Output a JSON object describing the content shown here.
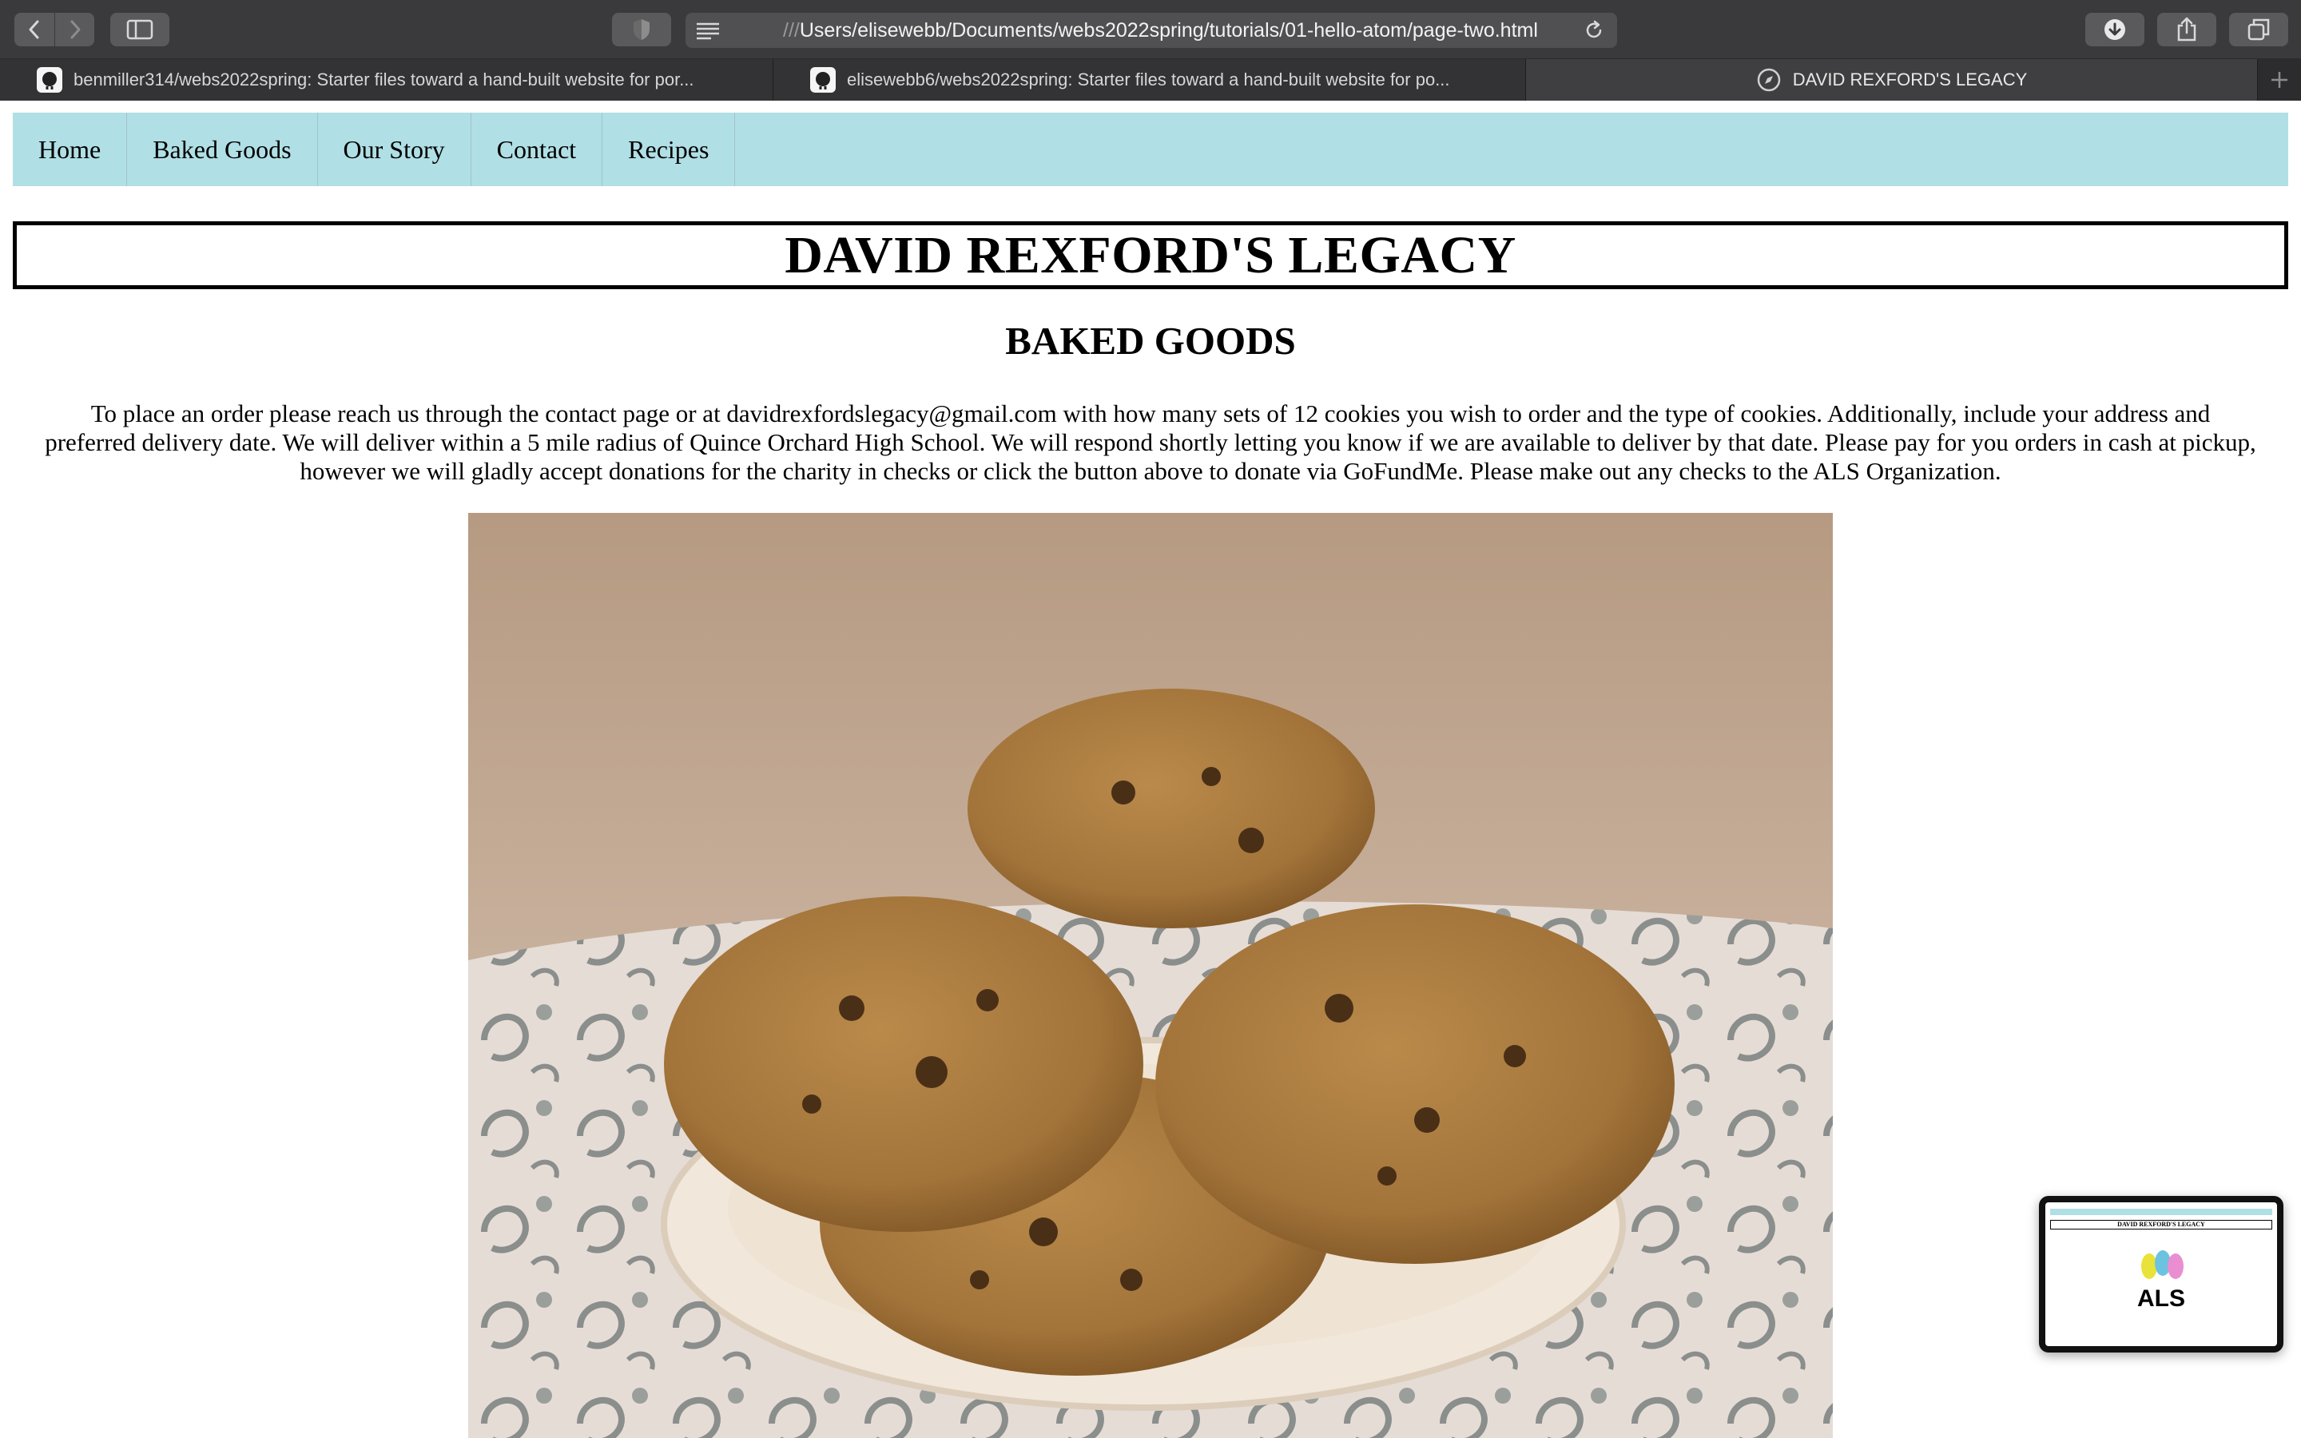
{
  "browser": {
    "url": "///Users/elisewebb/Documents/webs2022spring/tutorials/01-hello-atom/page-two.html",
    "tabs": [
      {
        "label": "benmiller314/webs2022spring: Starter files toward a hand-built website for por...",
        "icon": "github-icon"
      },
      {
        "label": "elisewebb6/webs2022spring: Starter files toward a hand-built website for po...",
        "icon": "github-icon"
      },
      {
        "label": "DAVID REXFORD'S LEGACY",
        "icon": "compass-icon"
      }
    ]
  },
  "nav": {
    "items": [
      "Home",
      "Baked Goods",
      "Our Story",
      "Contact",
      "Recipes"
    ]
  },
  "header": {
    "title": "DAVID REXFORD'S LEGACY"
  },
  "main": {
    "section_title": "BAKED GOODS",
    "intro": "To place an order please reach us through the contact page or at davidrexfordslegacy@gmail.com with how many sets of 12 cookies you wish to order and the type of cookies. Additionally, include your address and preferred delivery date. We will deliver within a 5 mile radius of Quince Orchard High School. We will respond shortly letting you know if we are available to deliver by that date. Please pay for you orders in cash at pickup, however we will gladly accept donations for the charity in checks or click the button above to donate via GoFundMe. Please make out any checks to the ALS Organization."
  },
  "thumbnail": {
    "title": "DAVID REXFORD'S LEGACY",
    "logo_text": "ALS"
  },
  "colors": {
    "nav_bg": "#b0dfe5",
    "chrome_bg": "#3a3a3c",
    "tab_bg": "#2c2c2e"
  }
}
